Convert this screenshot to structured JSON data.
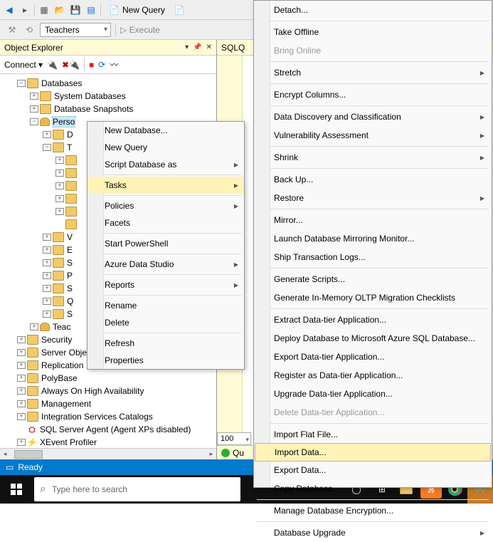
{
  "toolbar": {
    "new_query": "New Query",
    "execute": "Execute",
    "combo": "Teachers"
  },
  "explorer": {
    "title": "Object Explorer",
    "connect": "Connect",
    "nodes": {
      "databases": "Databases",
      "system_databases": "System Databases",
      "database_snapshots": "Database Snapshots",
      "sel_db": "Perso",
      "teac": "Teac",
      "security": "Security",
      "server_objects": "Server Objects",
      "replication": "Replication",
      "polybase": "PolyBase",
      "aoha": "Always On High Availability",
      "management": "Management",
      "isc": "Integration Services Catalogs",
      "agent": "SQL Server Agent (Agent XPs disabled)",
      "xevent": "XEvent Profiler"
    }
  },
  "query": {
    "tab": "SQLQ",
    "zoom": "100 %",
    "status": "Qu"
  },
  "ctx1": [
    {
      "label": "New Database...",
      "arrow": false
    },
    {
      "label": "New Query",
      "arrow": false
    },
    {
      "label": "Script Database as",
      "arrow": true
    },
    "-",
    {
      "label": "Tasks",
      "arrow": true,
      "hov": true
    },
    "-",
    {
      "label": "Policies",
      "arrow": true
    },
    {
      "label": "Facets",
      "arrow": false
    },
    "-",
    {
      "label": "Start PowerShell",
      "arrow": false
    },
    "-",
    {
      "label": "Azure Data Studio",
      "arrow": true
    },
    "-",
    {
      "label": "Reports",
      "arrow": true
    },
    "-",
    {
      "label": "Rename",
      "arrow": false
    },
    {
      "label": "Delete",
      "arrow": false
    },
    "-",
    {
      "label": "Refresh",
      "arrow": false
    },
    {
      "label": "Properties",
      "arrow": false
    }
  ],
  "ctx2": [
    {
      "label": "Detach...",
      "arrow": false
    },
    "-",
    {
      "label": "Take Offline",
      "arrow": false
    },
    {
      "label": "Bring Online",
      "arrow": false,
      "dis": true
    },
    "-",
    {
      "label": "Stretch",
      "arrow": true
    },
    "-",
    {
      "label": "Encrypt Columns...",
      "arrow": false
    },
    "-",
    {
      "label": "Data Discovery and Classification",
      "arrow": true
    },
    {
      "label": "Vulnerability Assessment",
      "arrow": true
    },
    "-",
    {
      "label": "Shrink",
      "arrow": true
    },
    "-",
    {
      "label": "Back Up...",
      "arrow": false
    },
    {
      "label": "Restore",
      "arrow": true
    },
    "-",
    {
      "label": "Mirror...",
      "arrow": false
    },
    {
      "label": "Launch Database Mirroring Monitor...",
      "arrow": false
    },
    {
      "label": "Ship Transaction Logs...",
      "arrow": false
    },
    "-",
    {
      "label": "Generate Scripts...",
      "arrow": false
    },
    {
      "label": "Generate In-Memory OLTP Migration Checklists",
      "arrow": false
    },
    "-",
    {
      "label": "Extract Data-tier Application...",
      "arrow": false
    },
    {
      "label": "Deploy Database to Microsoft Azure SQL Database...",
      "arrow": false
    },
    {
      "label": "Export Data-tier Application...",
      "arrow": false
    },
    {
      "label": "Register as Data-tier Application...",
      "arrow": false
    },
    {
      "label": "Upgrade Data-tier Application...",
      "arrow": false
    },
    {
      "label": "Delete Data-tier Application...",
      "arrow": false,
      "dis": true
    },
    "-",
    {
      "label": "Import Flat File...",
      "arrow": false
    },
    {
      "label": "Import Data...",
      "arrow": false,
      "hov": true
    },
    {
      "label": "Export Data...",
      "arrow": false
    },
    {
      "label": "Copy Database...",
      "arrow": false
    },
    "-",
    {
      "label": "Manage Database Encryption...",
      "arrow": false
    },
    "-",
    {
      "label": "Database Upgrade",
      "arrow": true
    }
  ],
  "status": {
    "ready": "Ready"
  },
  "search": {
    "placeholder": "Type here to search"
  }
}
